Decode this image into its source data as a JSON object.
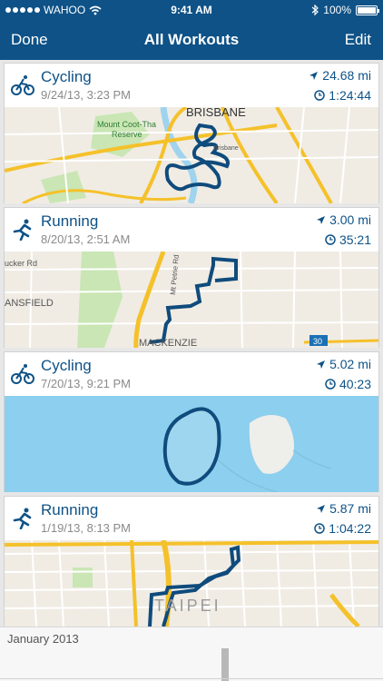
{
  "status": {
    "carrier": "WAHOO",
    "time": "9:41 AM",
    "battery": "100%",
    "battery_level": 1.0,
    "signal_bars": 5
  },
  "nav": {
    "done_label": "Done",
    "title": "All Workouts",
    "edit_label": "Edit"
  },
  "workouts": [
    {
      "type": "Cycling",
      "date": "9/24/13, 3:23 PM",
      "distance": "24.68 mi",
      "duration": "1:24:44",
      "map_labels": [
        "BRISBANE",
        "Mount Coot-Tha",
        "Reserve",
        "Brisbane"
      ]
    },
    {
      "type": "Running",
      "date": "8/20/13, 2:51 AM",
      "distance": "3.00 mi",
      "duration": "35:21",
      "map_labels": [
        "ucker Rd",
        "ANSFIELD",
        "MACKENZIE",
        "Mt Petrie Rd",
        "30"
      ]
    },
    {
      "type": "Cycling",
      "date": "7/20/13, 9:21 PM",
      "distance": "5.02 mi",
      "duration": "40:23",
      "map_labels": []
    },
    {
      "type": "Running",
      "date": "1/19/13, 8:13 PM",
      "distance": "5.87 mi",
      "duration": "1:04:22",
      "map_labels": [
        "TAIPEI"
      ]
    }
  ],
  "footer": {
    "month": "January 2013"
  },
  "colors": {
    "brand": "#0e5287",
    "route": "#0f4b7c",
    "water": "#8ccfee",
    "road": "#f5c12a",
    "park": "#c9e6b4"
  },
  "icons": {
    "cycling": "cyclist-icon",
    "running": "runner-icon",
    "distance": "location-arrow-icon",
    "duration": "clock-icon"
  }
}
